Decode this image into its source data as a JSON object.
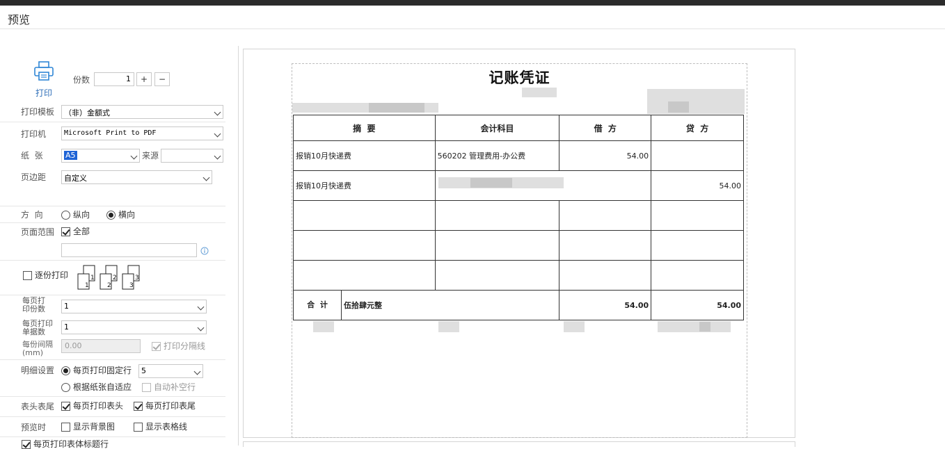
{
  "window": {
    "title": "预览"
  },
  "print": {
    "print_label": "打印",
    "copies_label": "份数",
    "copies_value": "1",
    "plus": "+",
    "minus": "−"
  },
  "template": {
    "label": "打印模板",
    "value": "（非）金额式"
  },
  "printer": {
    "label": "打印机",
    "value": "Microsoft Print to PDF"
  },
  "paper": {
    "label": "纸  张",
    "value": "A5",
    "source_label": "来源",
    "source_value": ""
  },
  "margin": {
    "label": "页边距",
    "value": "自定义"
  },
  "orientation": {
    "label": "方  向",
    "portrait": "纵向",
    "landscape": "横向",
    "selected": "landscape"
  },
  "page_range": {
    "label": "页面范围",
    "all_label": "全部",
    "all_checked": true,
    "range_value": ""
  },
  "collate": {
    "label": "逐份打印",
    "checked": false,
    "icons": [
      "1",
      "2",
      "3"
    ]
  },
  "per_page_copies": {
    "label": "每页打印份数",
    "value": "1"
  },
  "per_page_docs": {
    "label": "每页打印单据数",
    "value": "1"
  },
  "copy_gap": {
    "label": "每份间隔(mm)",
    "value": "0.00",
    "divider_label": "打印分隔线",
    "divider_checked": true
  },
  "detail": {
    "label": "明细设置",
    "fixed_rows_label": "每页打印固定行",
    "fixed_rows_value": "5",
    "auto_fit_label": "根据纸张自适应",
    "auto_fill_label": "自动补空行",
    "mode": "fixed"
  },
  "header_footer": {
    "label": "表头表尾",
    "header_label": "每页打印表头",
    "footer_label": "每页打印表尾",
    "header_checked": true,
    "footer_checked": true
  },
  "preview_opts": {
    "label": "预览时",
    "bg_label": "显示背景图",
    "grid_label": "显示表格线",
    "bg_checked": false,
    "grid_checked": false
  },
  "last_row": {
    "label": "每页打印表体标题行",
    "checked": true
  },
  "voucher": {
    "title": "记账凭证",
    "headers": [
      "摘  要",
      "会计科目",
      "借  方",
      "贷  方"
    ],
    "rows": [
      {
        "summary": "报销10月快递费",
        "account": "560202 管理费用-办公费",
        "debit": "54.00",
        "credit": ""
      },
      {
        "summary": "报销10月快递费",
        "account": "",
        "debit": "",
        "credit": "54.00"
      },
      {
        "summary": "",
        "account": "",
        "debit": "",
        "credit": ""
      },
      {
        "summary": "",
        "account": "",
        "debit": "",
        "credit": ""
      },
      {
        "summary": "",
        "account": "",
        "debit": "",
        "credit": ""
      }
    ],
    "total_label": "合  计",
    "total_words": "伍拾肆元整",
    "total_debit": "54.00",
    "total_credit": "54.00"
  }
}
